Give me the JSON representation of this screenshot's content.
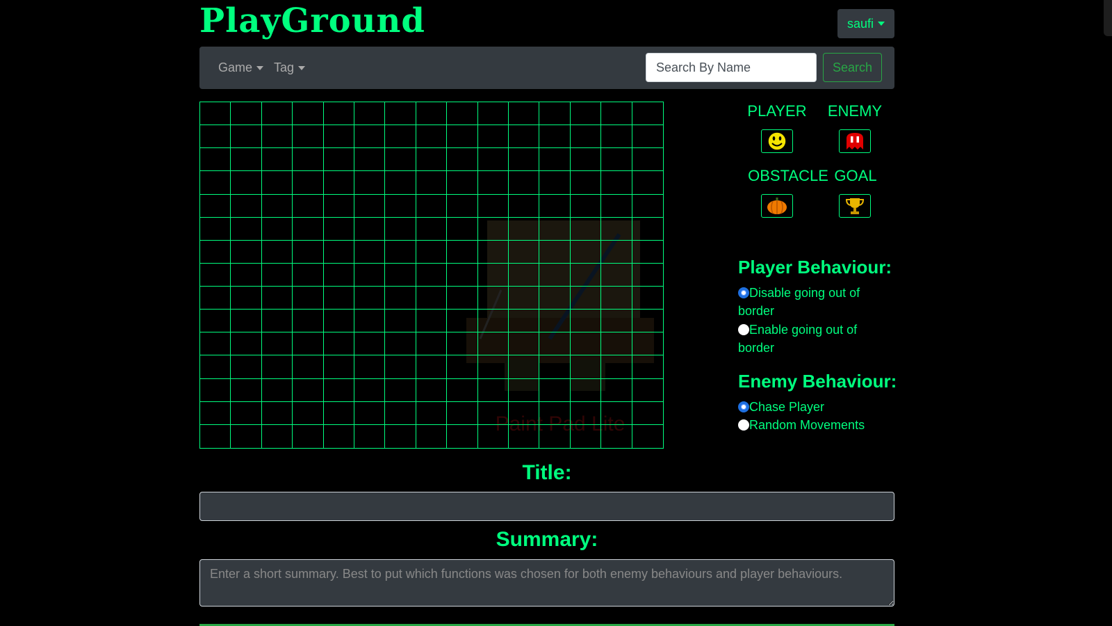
{
  "brand": "PlayGround",
  "user_menu": {
    "label": "saufi"
  },
  "nav": {
    "items": [
      {
        "label": "Game"
      },
      {
        "label": "Tag"
      }
    ],
    "search": {
      "placeholder": "Search By Name",
      "button_label": "Search"
    }
  },
  "watermark": {
    "text": "Paint Pad Lite"
  },
  "grid": {
    "rows": 15,
    "cols": 15
  },
  "palette": {
    "player": {
      "label": "PLAYER",
      "icon": "smiley-icon"
    },
    "enemy": {
      "label": "ENEMY",
      "icon": "ghost-icon"
    },
    "obstacle": {
      "label": "OBSTACLE",
      "icon": "pumpkin-icon"
    },
    "goal": {
      "label": "GOAL",
      "icon": "trophy-icon"
    }
  },
  "player_behaviour": {
    "title": "Player Behaviour:",
    "options": [
      {
        "label": "Disable going out of border",
        "checked": true
      },
      {
        "label": "Enable going out of border",
        "checked": false
      }
    ]
  },
  "enemy_behaviour": {
    "title": "Enemy Behaviour:",
    "options": [
      {
        "label": "Chase Player",
        "checked": true
      },
      {
        "label": "Random Movements",
        "checked": false
      }
    ]
  },
  "form": {
    "title_label": "Title:",
    "title_value": "",
    "summary_label": "Summary:",
    "summary_placeholder": "Enter a short summary. Best to put which functions was chosen for both enemy behaviours and player behaviours."
  },
  "colors": {
    "accent": "#00ff7f",
    "navbar": "#343a40",
    "search_button": "#28a745",
    "radio_selected": "#1e6fe0"
  }
}
